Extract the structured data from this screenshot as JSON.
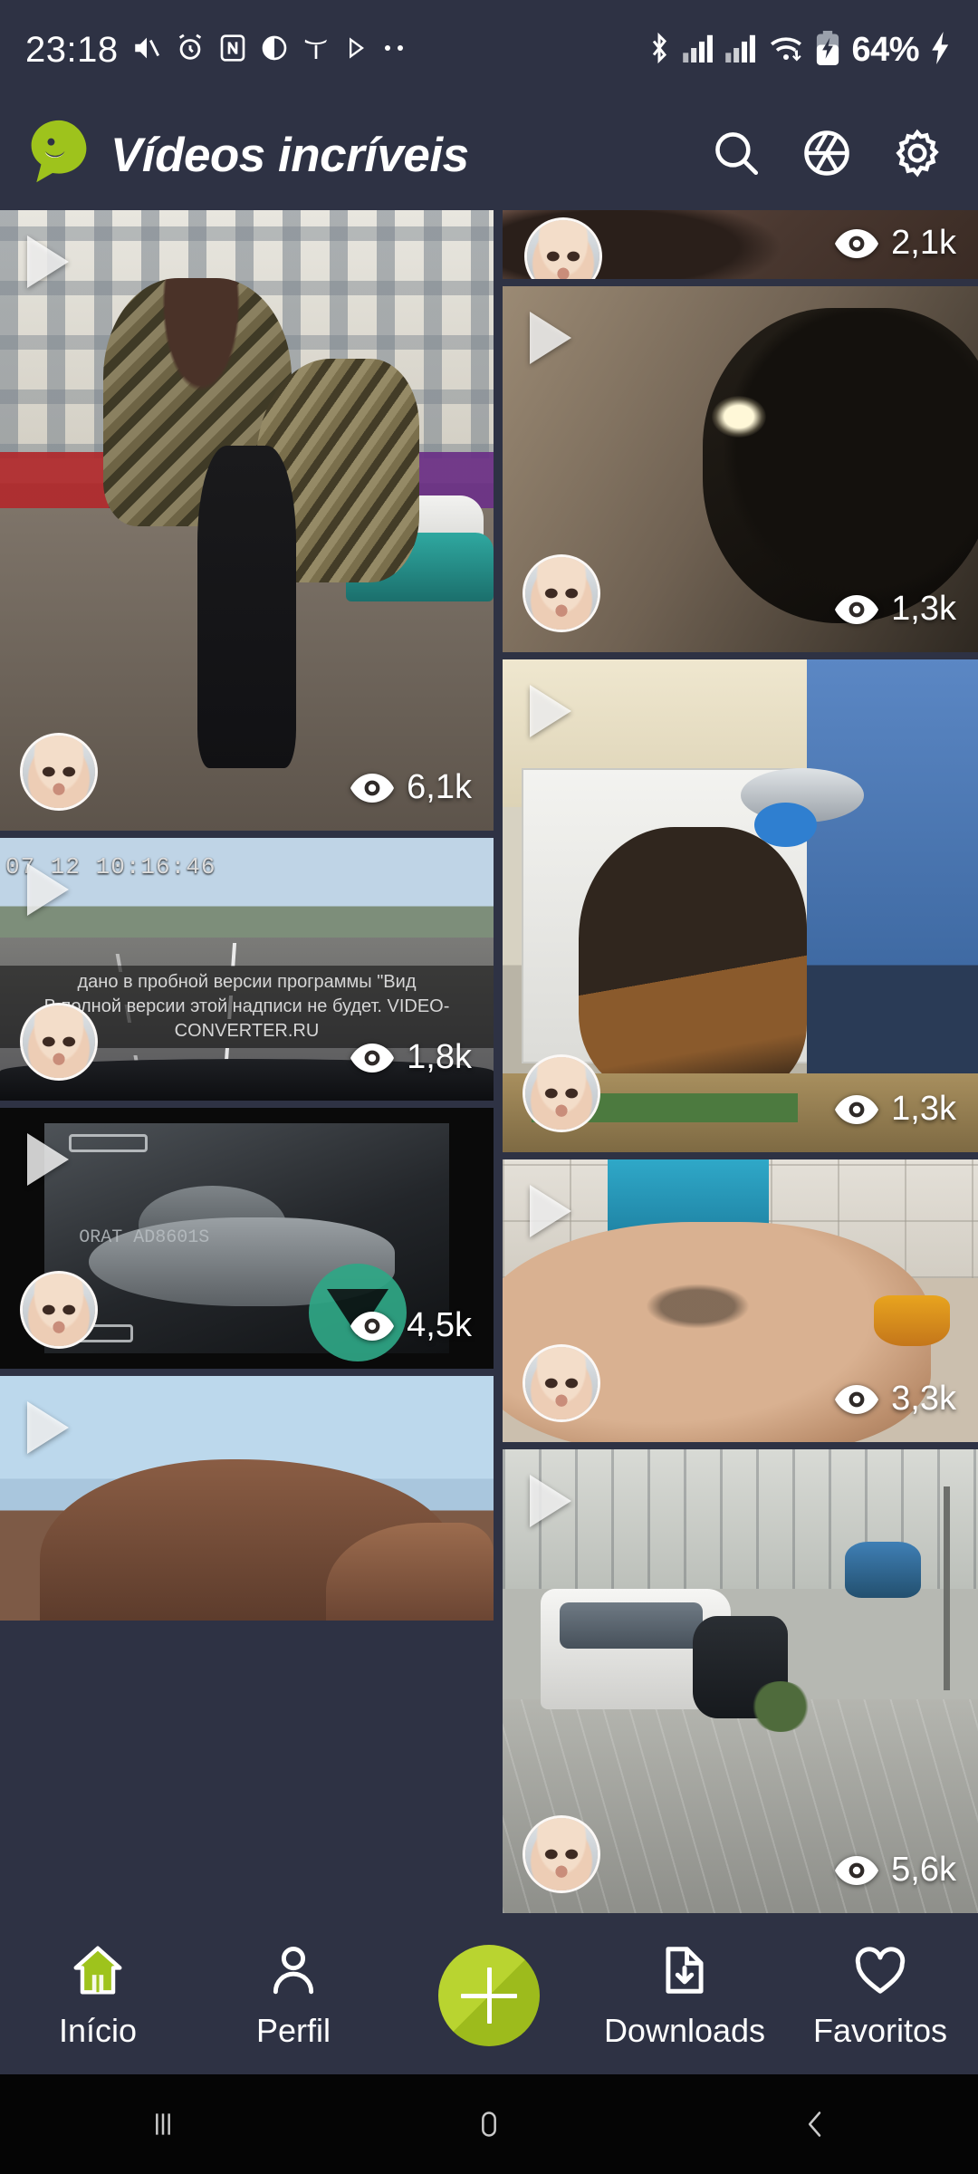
{
  "status_bar": {
    "time": "23:18",
    "battery_percent": "64%",
    "left_icons": [
      "mute-icon",
      "alarm-icon",
      "nfc-icon",
      "do-not-disturb-icon",
      "tesla-icon",
      "play-store-icon",
      "more-icons"
    ],
    "right_icons": [
      "bluetooth-icon",
      "signal-sim1-icon",
      "signal-sim2-icon",
      "wifi-icon",
      "battery-charging-icon",
      "charging-bolt-icon"
    ]
  },
  "header": {
    "title": "Vídeos incríveis",
    "logo": "chat-bubble-smiley-logo",
    "accent_color": "#9ec31c",
    "background_color": "#2e3244",
    "actions": [
      {
        "name": "search-icon",
        "label": "Pesquisar"
      },
      {
        "name": "aperture-icon",
        "label": "Câmera"
      },
      {
        "name": "gear-icon",
        "label": "Configurações"
      }
    ]
  },
  "feed": {
    "left_column": [
      {
        "id": "video-street-fight",
        "scene": "street",
        "views": "6,1k",
        "play": "play-icon",
        "avatar": "user-avatar"
      },
      {
        "id": "video-dashcam-highway",
        "scene": "road",
        "views": "1,8k",
        "play": "play-icon",
        "avatar": "user-avatar",
        "overlay_timestamp": "07      12  10:16:46",
        "watermark_line1": "дано в пробной версии программы \"Вид",
        "watermark_line2": "В полной версии этой надписи не будет. VIDEO-CONVERTER.RU"
      },
      {
        "id": "video-night-ir",
        "scene": "ir",
        "views": "4,5k",
        "play": "play-icon",
        "avatar": "user-avatar",
        "badge": "converter-watermark-badge",
        "overlay_text": "ORAT\nAD8601S"
      },
      {
        "id": "video-desert-mountain",
        "scene": "desert",
        "views": "",
        "play": "play-icon",
        "avatar": ""
      }
    ],
    "right_column": [
      {
        "id": "video-brown-rock",
        "scene": "brownrock",
        "views": "2,1k",
        "play": "",
        "avatar": "user-avatar"
      },
      {
        "id": "video-dog-dark",
        "scene": "dogdark",
        "views": "1,3k",
        "play": "play-icon",
        "avatar": "user-avatar"
      },
      {
        "id": "video-dog-bowl",
        "scene": "dogbowl",
        "views": "1,3k",
        "play": "play-icon",
        "avatar": "user-avatar"
      },
      {
        "id": "video-skin-tiles",
        "scene": "skin",
        "views": "3,3k",
        "play": "play-icon",
        "avatar": "user-avatar"
      },
      {
        "id": "video-street-crash",
        "scene": "crash",
        "views": "5,6k",
        "play": "play-icon",
        "avatar": "user-avatar"
      }
    ]
  },
  "bottom_nav": {
    "items": [
      {
        "name": "nav-inicio",
        "label": "Início",
        "icon": "home-icon",
        "active": true
      },
      {
        "name": "nav-perfil",
        "label": "Perfil",
        "icon": "person-icon",
        "active": false
      },
      {
        "name": "nav-add",
        "label": "",
        "icon": "plus-icon",
        "active": false
      },
      {
        "name": "nav-downloads",
        "label": "Downloads",
        "icon": "folder-download-icon",
        "active": false
      },
      {
        "name": "nav-favoritos",
        "label": "Favoritos",
        "icon": "heart-icon",
        "active": false
      }
    ]
  },
  "android_nav": {
    "recents": "recents-icon",
    "home": "home-button-icon",
    "back": "back-icon"
  }
}
